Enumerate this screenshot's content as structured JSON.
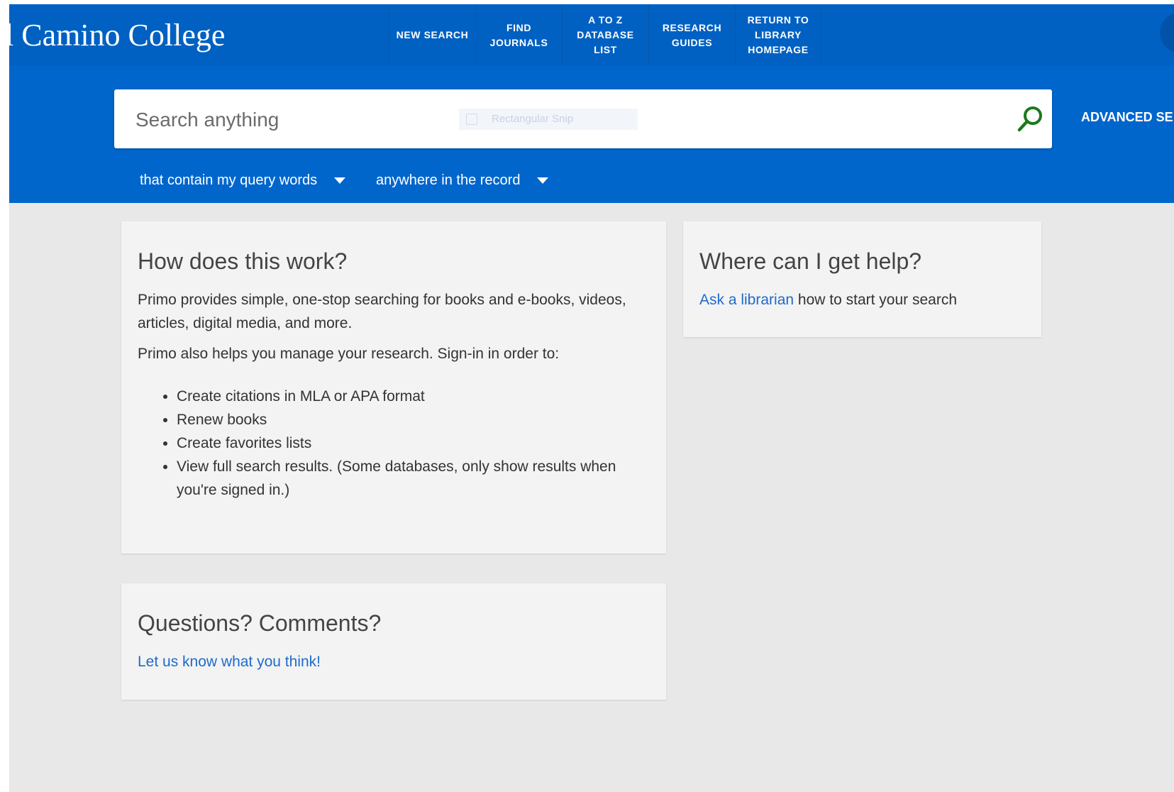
{
  "header": {
    "logo_text": "l Camino College",
    "nav": [
      {
        "label": "NEW SEARCH"
      },
      {
        "label": "FIND\nJOURNALS"
      },
      {
        "label": "A TO Z\nDATABASE\nLIST"
      },
      {
        "label": "RESEARCH\nGUIDES"
      },
      {
        "label": "RETURN TO\nLIBRARY\nHOMEPAGE"
      }
    ]
  },
  "search": {
    "placeholder": "Search anything",
    "ghost_overlay": "Rectangular Snip",
    "advanced_label": "ADVANCED SE",
    "dropdowns": [
      {
        "label": "that contain my query words"
      },
      {
        "label": "anywhere in the record"
      }
    ]
  },
  "colors": {
    "header_bg": "#0061c2",
    "search_band_bg": "#0066cc",
    "search_icon": "#1a7a1a",
    "link": "#1f6bc9"
  },
  "icons": {
    "search": "search-icon",
    "caret": "caret-down-icon"
  },
  "cards": {
    "how": {
      "title": "How does this work?",
      "para1": "Primo provides simple, one-stop searching for books and e-books, videos, articles, digital media, and more.",
      "para2": "Primo also helps you manage your research. Sign-in in order to:",
      "bullets": [
        "Create citations in MLA or APA format",
        "Renew books",
        "Create favorites lists",
        "View full search results. (Some databases, only show results when you're signed in.)"
      ]
    },
    "help": {
      "title": "Where can I get help?",
      "link_text": "Ask a librarian",
      "rest_text": " how to start your search"
    },
    "questions": {
      "title": "Questions? Comments?",
      "link_text": "Let us know what you think!"
    }
  }
}
